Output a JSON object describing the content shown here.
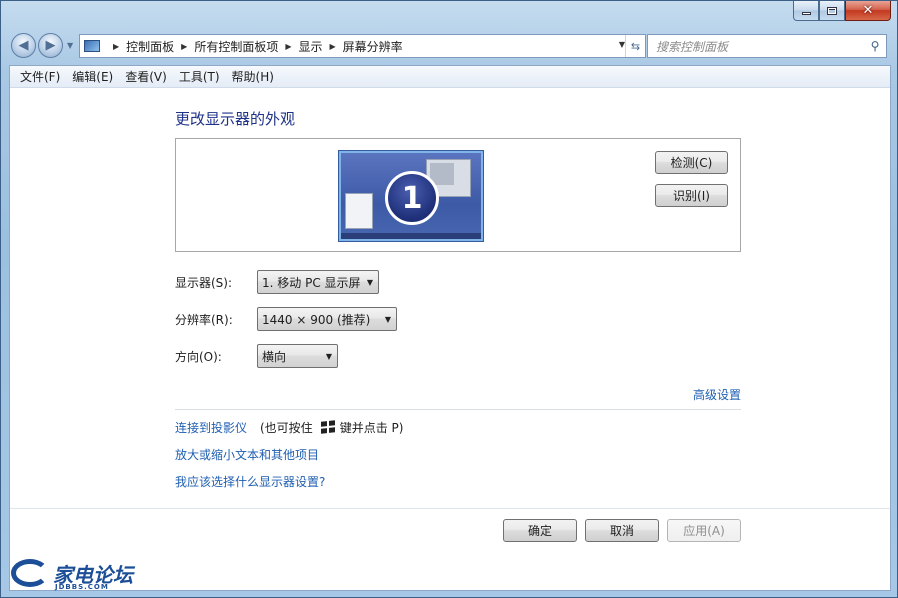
{
  "window": {
    "controls": {
      "minimize_icon": "minimize-icon",
      "maximize_icon": "maximize-icon",
      "close_glyph": "✕"
    }
  },
  "navigation": {
    "back_glyph": "◀",
    "forward_glyph": "▶",
    "breadcrumbs": [
      "控制面板",
      "所有控制面板项",
      "显示",
      "屏幕分辨率"
    ],
    "search_placeholder": "搜索控制面板"
  },
  "menu": [
    "文件(F)",
    "编辑(E)",
    "查看(V)",
    "工具(T)",
    "帮助(H)"
  ],
  "main": {
    "heading": "更改显示器的外观",
    "monitor_number": "1",
    "detect_label": "检测(C)",
    "identify_label": "识别(I)",
    "display_label": "显示器(S):",
    "display_value": "1. 移动 PC 显示屏",
    "resolution_label": "分辨率(R):",
    "resolution_value": "1440 × 900 (推荐)",
    "orientation_label": "方向(O):",
    "orientation_value": "横向",
    "advanced_link": "高级设置",
    "projector_link": "连接到投影仪",
    "projector_note_prefix": "(也可按住",
    "projector_note_suffix": "键并点击 P)",
    "zoom_link": "放大或缩小文本和其他项目",
    "which_link": "我应该选择什么显示器设置?"
  },
  "footer": {
    "ok_label": "确定",
    "cancel_label": "取消",
    "apply_label": "应用(A)"
  },
  "watermark": {
    "title": "家电论坛",
    "subtitle": "JDBBS.COM"
  },
  "colors": {
    "link": "#1f5fb1",
    "heading": "#1e3287",
    "frame": "#9cc0e0"
  }
}
